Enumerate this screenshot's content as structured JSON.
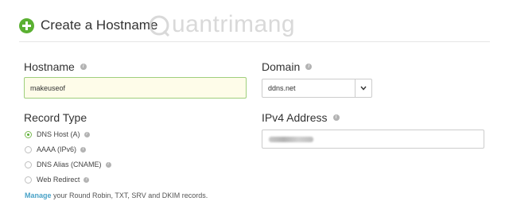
{
  "header": {
    "title": "Create a Hostname"
  },
  "watermark": {
    "text": "uantrimang"
  },
  "hostname": {
    "label": "Hostname",
    "value": "makeuseof"
  },
  "domain": {
    "label": "Domain",
    "value": "ddns.net"
  },
  "record_type": {
    "label": "Record Type",
    "options": [
      {
        "label": "DNS Host (A)",
        "selected": true
      },
      {
        "label": "AAAA (IPv6)",
        "selected": false
      },
      {
        "label": "DNS Alias (CNAME)",
        "selected": false
      },
      {
        "label": "Web Redirect",
        "selected": false
      }
    ]
  },
  "ipv4": {
    "label": "IPv4 Address"
  },
  "manage": {
    "link": "Manage",
    "rest": " your Round Robin, TXT, SRV and DKIM records."
  },
  "colors": {
    "accent_green": "#5ab031",
    "link_blue": "#4aa3c8",
    "input_highlight": "#fefce9"
  },
  "icons": [
    "plus-circle-icon",
    "info-icon",
    "chevron-down-icon"
  ]
}
